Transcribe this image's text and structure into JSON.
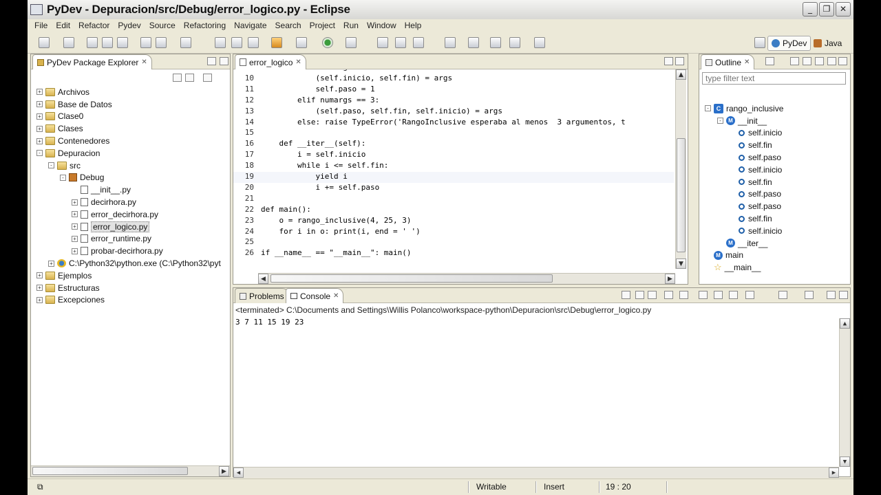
{
  "window": {
    "title": "PyDev - Depuracion/src/Debug/error_logico.py - Eclipse",
    "controls": [
      "_",
      "❐",
      "✕"
    ]
  },
  "menu": [
    "File",
    "Edit",
    "Refactor",
    "Pydev",
    "Source",
    "Refactoring",
    "Navigate",
    "Search",
    "Project",
    "Run",
    "Window",
    "Help"
  ],
  "perspectives": [
    "PyDev",
    "Java"
  ],
  "package_explorer": {
    "tab": "PyDev Package Explorer",
    "tree": [
      {
        "label": "Archivos",
        "depth": 0,
        "icon": "folder",
        "exp": "+"
      },
      {
        "label": "Base de Datos",
        "depth": 0,
        "icon": "folder",
        "exp": "+"
      },
      {
        "label": "Clase0",
        "depth": 0,
        "icon": "folder",
        "exp": "+"
      },
      {
        "label": "Clases",
        "depth": 0,
        "icon": "folder",
        "exp": "+"
      },
      {
        "label": "Contenedores",
        "depth": 0,
        "icon": "folder",
        "exp": "+"
      },
      {
        "label": "Depuracion",
        "depth": 0,
        "icon": "folder",
        "exp": "-"
      },
      {
        "label": "src",
        "depth": 1,
        "icon": "folder",
        "exp": "-"
      },
      {
        "label": "Debug",
        "depth": 2,
        "icon": "pkg",
        "exp": "-"
      },
      {
        "label": "__init__.py",
        "depth": 3,
        "icon": "pyfile",
        "exp": ""
      },
      {
        "label": "decirhora.py",
        "depth": 3,
        "icon": "pyfile",
        "exp": "+"
      },
      {
        "label": "error_decirhora.py",
        "depth": 3,
        "icon": "pyfile",
        "exp": "+"
      },
      {
        "label": "error_logico.py",
        "depth": 3,
        "icon": "pyfile",
        "exp": "+",
        "selected": true
      },
      {
        "label": "error_runtime.py",
        "depth": 3,
        "icon": "pyfile",
        "exp": "+"
      },
      {
        "label": "probar-decirhora.py",
        "depth": 3,
        "icon": "pyfile",
        "exp": "+"
      },
      {
        "label": "C:\\Python32\\python.exe  (C:\\Python32\\pyt",
        "depth": 1,
        "icon": "pyexe",
        "exp": "+"
      },
      {
        "label": "Ejemplos",
        "depth": 0,
        "icon": "folder",
        "exp": "+"
      },
      {
        "label": "Estructuras",
        "depth": 0,
        "icon": "folder",
        "exp": "+"
      },
      {
        "label": "Excepciones",
        "depth": 0,
        "icon": "folder",
        "exp": "+"
      }
    ]
  },
  "editor": {
    "tab": "error_logico",
    "lines": [
      {
        "n": "",
        "text": "        elif numargs == 3:"
      },
      {
        "n": "10",
        "text": "            (self.inicio, self.fin) = args"
      },
      {
        "n": "11",
        "text": "            self.paso = 1"
      },
      {
        "n": "12",
        "text": "        elif numargs == 3:"
      },
      {
        "n": "13",
        "text": "            (self.paso, self.fin, self.inicio) = args"
      },
      {
        "n": "14",
        "text": "        else: raise TypeError('RangoInclusive esperaba al menos  3 argumentos, t"
      },
      {
        "n": "15",
        "text": ""
      },
      {
        "n": "16",
        "text": "    def __iter__(self):"
      },
      {
        "n": "17",
        "text": "        i = self.inicio"
      },
      {
        "n": "18",
        "text": "        while i <= self.fin:"
      },
      {
        "n": "19",
        "text": "            yield i"
      },
      {
        "n": "20",
        "text": "            i += self.paso"
      },
      {
        "n": "21",
        "text": ""
      },
      {
        "n": "22",
        "text": "def main():"
      },
      {
        "n": "23",
        "text": "    o = rango_inclusive(4, 25, 3)"
      },
      {
        "n": "24",
        "text": "    for i in o: print(i, end = ' ')"
      },
      {
        "n": "25",
        "text": ""
      },
      {
        "n": "26",
        "text": "if __name__ == \"__main__\": main()"
      }
    ]
  },
  "outline": {
    "tab": "Outline",
    "filter_placeholder": "type filter text",
    "tree": [
      {
        "label": "rango_inclusive",
        "depth": 0,
        "icon": "class",
        "exp": "-"
      },
      {
        "label": "__init__",
        "depth": 1,
        "icon": "method",
        "exp": "-"
      },
      {
        "label": "self.inicio",
        "depth": 2,
        "icon": "attr"
      },
      {
        "label": "self.fin",
        "depth": 2,
        "icon": "attr"
      },
      {
        "label": "self.paso",
        "depth": 2,
        "icon": "attr"
      },
      {
        "label": "self.inicio",
        "depth": 2,
        "icon": "attr"
      },
      {
        "label": "self.fin",
        "depth": 2,
        "icon": "attr"
      },
      {
        "label": "self.paso",
        "depth": 2,
        "icon": "attr"
      },
      {
        "label": "self.paso",
        "depth": 2,
        "icon": "attr"
      },
      {
        "label": "self.fin",
        "depth": 2,
        "icon": "attr"
      },
      {
        "label": "self.inicio",
        "depth": 2,
        "icon": "attr"
      },
      {
        "label": "__iter__",
        "depth": 1,
        "icon": "method"
      },
      {
        "label": "main",
        "depth": 0,
        "icon": "method"
      },
      {
        "label": "__main__",
        "depth": 0,
        "icon": "star"
      }
    ]
  },
  "console": {
    "tabs": [
      "Problems",
      "Console"
    ],
    "header": "<terminated> C:\\Documents and Settings\\Willis Polanco\\workspace-python\\Depuracion\\src\\Debug\\error_logico.py",
    "output": "3 7 11 15 19 23"
  },
  "status": {
    "writable": "Writable",
    "mode": "Insert",
    "position": "19 : 20"
  }
}
